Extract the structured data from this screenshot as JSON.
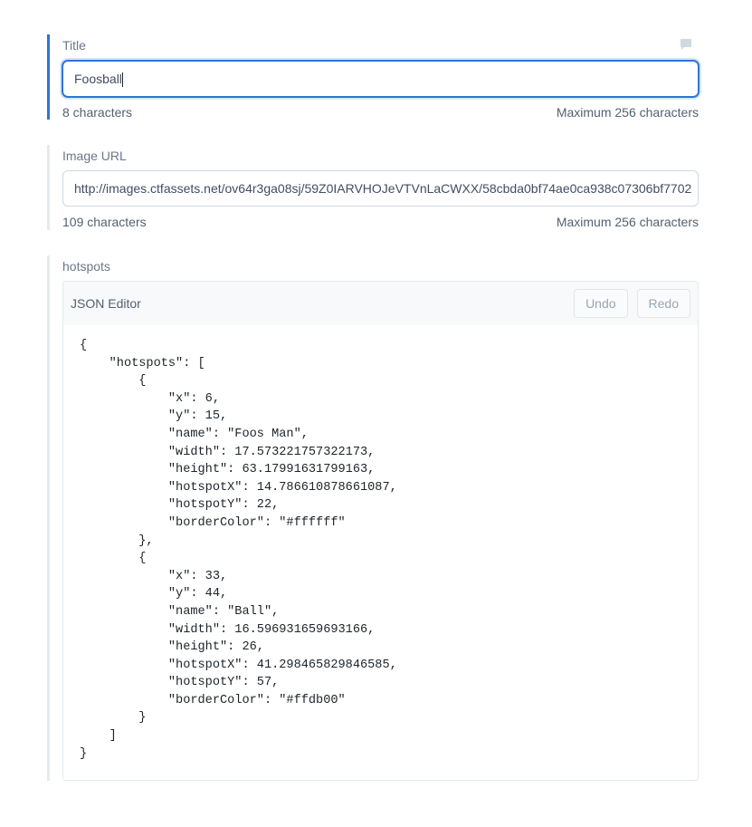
{
  "title_field": {
    "label": "Title",
    "value": "Foosball",
    "char_count": "8 characters",
    "max_chars": "Maximum 256 characters"
  },
  "image_url_field": {
    "label": "Image URL",
    "value": "http://images.ctfassets.net/ov64r3ga08sj/59Z0IARVHOJeVTVnLaCWXX/58cbda0bf74ae0ca938c07306bf7702",
    "char_count": "109 characters",
    "max_chars": "Maximum 256 characters"
  },
  "hotspots_field": {
    "label": "hotspots",
    "editor_title": "JSON Editor",
    "undo_label": "Undo",
    "redo_label": "Redo",
    "json_text": "{\n    \"hotspots\": [\n        {\n            \"x\": 6,\n            \"y\": 15,\n            \"name\": \"Foos Man\",\n            \"width\": 17.573221757322173,\n            \"height\": 63.17991631799163,\n            \"hotspotX\": 14.786610878661087,\n            \"hotspotY\": 22,\n            \"borderColor\": \"#ffffff\"\n        },\n        {\n            \"x\": 33,\n            \"y\": 44,\n            \"name\": \"Ball\",\n            \"width\": 16.596931659693166,\n            \"height\": 26,\n            \"hotspotX\": 41.298465829846585,\n            \"hotspotY\": 57,\n            \"borderColor\": \"#ffdb00\"\n        }\n    ]\n}"
  },
  "colors": {
    "accent": "#2e75d4",
    "inactive_bar": "#e5ebed"
  },
  "icons": {
    "comment": "comment-icon"
  }
}
